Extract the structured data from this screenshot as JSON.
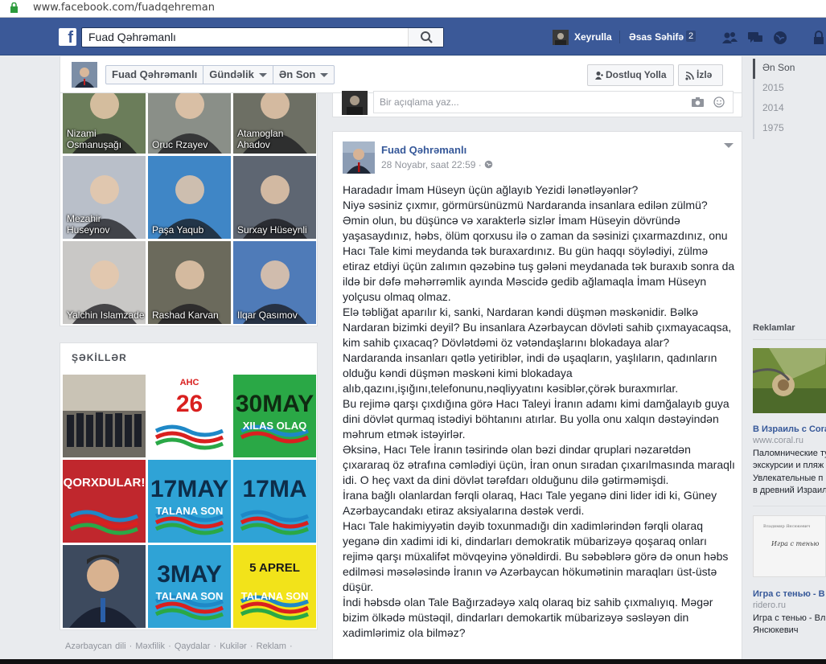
{
  "browser": {
    "url": "www.facebook.com/fuadqehreman"
  },
  "topbar": {
    "search_value": "Fuad Qəhrəmanlı",
    "user_name": "Xeyrulla",
    "home_label": "Əsas Səhifə",
    "home_count": "2"
  },
  "page_header": {
    "crumbs": [
      "Fuad Qəhrəmanlı",
      "Gündəlik",
      "Ən Son"
    ],
    "add_friend_label": "Dostluq Yolla",
    "follow_label": "İzlə"
  },
  "timeline_years": [
    "Ən Son",
    "2015",
    "2014",
    "1975"
  ],
  "friends": [
    {
      "name": "Nizami Osmanuşağı",
      "bg": "#6b7d5a"
    },
    {
      "name": "Oruc Rzayev",
      "bg": "#8a8f88"
    },
    {
      "name": "Atamoglan Ahadov",
      "bg": "#6d6f64"
    },
    {
      "name": "Mezahir Huseynov",
      "bg": "#b9bfc9"
    },
    {
      "name": "Paşa Yaqub",
      "bg": "#3f86c6"
    },
    {
      "name": "Surxay Hüseynli",
      "bg": "#5e6672"
    },
    {
      "name": "Yalchin Islamzade",
      "bg": "#c9c8c6"
    },
    {
      "name": "Rashad Karvan",
      "bg": "#6b6a5c"
    },
    {
      "name": "Ilqar Qasımov",
      "bg": "#4f7bb8"
    }
  ],
  "photos": {
    "title": "ŞƏKİLLƏR",
    "tiles": [
      {
        "label": "",
        "bg": "#9b9c96",
        "fg": "#ffffff"
      },
      {
        "label": "26",
        "sub": "AHC",
        "bg": "#ffffff",
        "fg": "#d9201f"
      },
      {
        "label": "30MAY",
        "sub": "XILAS OLAQ",
        "bg": "#2aa846",
        "fg": "#0f2a12"
      },
      {
        "label": "QORXDULAR!",
        "sub": "",
        "bg": "#c0272d",
        "fg": "#ffffff"
      },
      {
        "label": "17MAY",
        "sub": "TALANA SON",
        "bg": "#2fa3d6",
        "fg": "#0d2d4a"
      },
      {
        "label": "17MA",
        "sub": "",
        "bg": "#2fa3d6",
        "fg": "#0d2d4a"
      },
      {
        "label": "",
        "bg": "#3d4a5e",
        "fg": "#ffffff"
      },
      {
        "label": "3MAY",
        "sub": "TALANA SON",
        "bg": "#2fa3d6",
        "fg": "#0d2d4a"
      },
      {
        "label": "5 APREL",
        "sub": "TALANA SON",
        "bg": "#f2e31a",
        "fg": "#1a1a1a"
      }
    ]
  },
  "footer": {
    "links": "Azərbaycan dili · Məxfilik · Qaydalar · Kukilər · Reklam ·"
  },
  "composer": {
    "placeholder": "Bir açıqlama yaz..."
  },
  "post": {
    "author": "Fuad Qəhrəmanlı",
    "time": "28 Noyabr, saat 22:59 · ",
    "body": "Haradadır İmam Hüseyn üçün ağlayıb Yezidi lənətləyənlər?\nNiyə səsiniz çıxmır, görmürsünüzmü Nardaranda insanlara edilən zülmü?\nƏmin olun, bu düşüncə və xarakterlə sizlər İmam Hüseyin dövründə yaşasaydınız, həbs, ölüm qorxusu ilə o zaman da səsinizi çıxarmazdınız, onu Hacı Tale kimi meydanda tək buraxardınız. Bu gün haqqı söylədiyi, zülmə etiraz etdiyi üçün zalımın qəzəbinə tuş gələni meydanada tək buraxıb sonra da ildə bir dəfə məhərrəmlik ayında Məscidə gedib ağlamaqla İmam Hüseyn yolçusu olmaq olmaz.\nElə təbliğat aparılır ki, sanki, Nardaran kəndi düşmən məskənidir. Bəlkə Nardaran bizimki deyil? Bu insanlara Azərbaycan dövləti sahib çıxmayacaqsa, kim sahib çıxacaq? Dövlətdəmi öz vətəndaşlarını blokadaya alar?\nNardaranda insanları qətlə yetiriblər, indi də uşaqların, yaşlıların, qadınların olduğu kəndi düşmən məskəni kimi blokadaya alıb,qazını,işığını,telefonunu,nəqliyyatını kəsiblər,çörək buraxmırlar.\nBu rejimə qarşı çıxdığına görə Hacı Taleyi İranın adamı kimi damğalayıb guya dini dövlət qurmaq istədiyi böhtanını atırlar. Bu yolla onu xalqın dəstəyindən məhrum etmək istəyirlər.\nƏksinə, Hacı Tele İranın təsirində olan bəzi dindar qruplari nəzarətdən çıxararaq öz ətrafına cəmlədiyi üçün, İran onun sıradan çıxarılmasında maraqlı idi. O heç vaxt da dini dövlət tərəfdarı olduğunu dilə gətirməmişdi.\nİrana bağlı olanlardan fərqli olaraq, Hacı Tale yeganə dini lider idi ki, Güney Azərbaycandakı etiraz aksiyalarına dəstək verdi.\nHacı Tale hakimiyyətin dəyib toxunmadığı din xadimlərindən fərqli olaraq yeganə din xadimi idi ki, dindarları demokratik mübarizəyə qoşaraq onları rejimə qarşı müxalifət mövqeyinə yönəldirdi. Bu səbəblərə görə də onun həbs edilməsi məsələsində İranın və Azərbaycan hökumətinin maraqları üst-üstə düşür.\nİndi həbsdə olan Tale Bağırzadəyə xalq olaraq biz sahib çıxmalıyıq. Məgər bizim ölkədə müstəqil, dindarları demokartik mübarizəyə səsləyən din xadimlərimiz ola bilməz?"
  },
  "ads": {
    "title": "Reklamlar",
    "ad1": {
      "headline": "В Израиль с Cora",
      "url": "www.coral.ru",
      "text": [
        "Паломнические ту",
        "экскурсии и пляж",
        "Увлекательные п",
        "в древний Израил"
      ]
    },
    "ad2": {
      "img_line1": "Владимир Янсюкевич",
      "img_line2": "Игра с тенью",
      "headline": "Игра с тенью - В",
      "url": "ridero.ru",
      "text": [
        "Игра с тенью - Вл",
        "Янсюкевич"
      ]
    }
  },
  "colors": {
    "brand": "#3b5998",
    "link": "#365899",
    "page_bg": "#e9ebee"
  }
}
